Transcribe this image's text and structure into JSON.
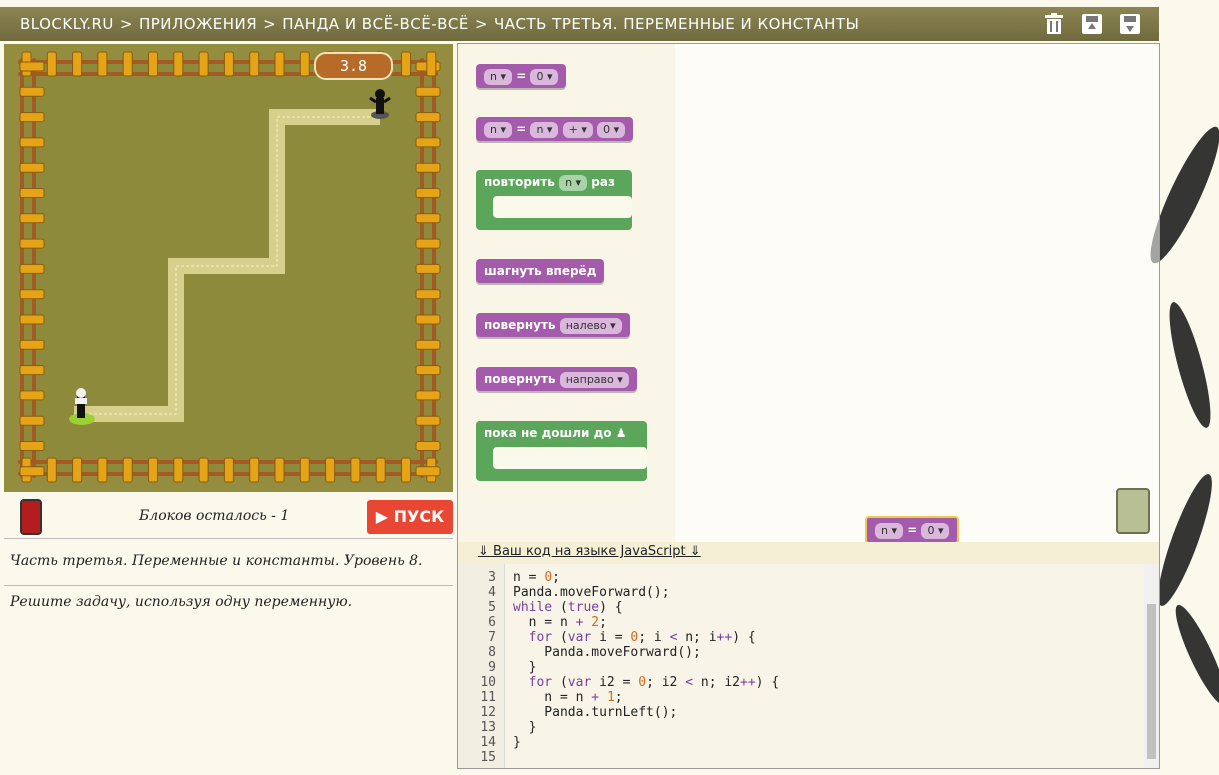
{
  "header": {
    "breadcrumb": [
      "BLOCKLY.RU",
      "ПРИЛОЖЕНИЯ",
      "ПАНДА И ВСЁ-ВСЁ-ВСЁ",
      "ЧАСТЬ ТРЕТЬЯ. ПЕРЕМЕННЫЕ И КОНСТАНТЫ"
    ],
    "separator": ">",
    "icons": [
      "trash-icon",
      "import-icon",
      "export-icon"
    ]
  },
  "game": {
    "timer": "3.8"
  },
  "status": {
    "blocks_left": "Блоков осталось - 1",
    "run_label": "ПУСК"
  },
  "level_title": "Часть третья. Переменные и константы. Уровень 8.",
  "task": "Решите задачу, используя одну переменную.",
  "toolbox": {
    "set_var": {
      "var": "n",
      "eq": "=",
      "value": "0"
    },
    "set_expr": {
      "var": "n",
      "eq": "=",
      "left": "n",
      "op": "+",
      "right": "0"
    },
    "repeat": {
      "label": "повторить",
      "var": "n",
      "suffix": "раз"
    },
    "step": {
      "label": "шагнуть вперёд"
    },
    "turn_left": {
      "label": "повернуть",
      "dir": "налево"
    },
    "turn_right": {
      "label": "повернуть",
      "dir": "направо"
    },
    "while": {
      "label": "пока не дошли до"
    }
  },
  "workspace_block": {
    "var": "n",
    "eq": "=",
    "value": "0"
  },
  "code": {
    "title": "Ваш код на языке JavaScript",
    "lines": [
      {
        "n": "3",
        "t": "n = 0;"
      },
      {
        "n": "4",
        "t": "Panda.moveForward();"
      },
      {
        "n": "5",
        "t": "while (true) {"
      },
      {
        "n": "6",
        "t": "  n = n + 2;"
      },
      {
        "n": "7",
        "t": "  for (var i = 0; i < n; i++) {"
      },
      {
        "n": "8",
        "t": "    Panda.moveForward();"
      },
      {
        "n": "9",
        "t": "  }"
      },
      {
        "n": "10",
        "t": "  for (var i2 = 0; i2 < n; i2++) {"
      },
      {
        "n": "11",
        "t": "    n = n + 1;"
      },
      {
        "n": "12",
        "t": "    Panda.turnLeft();"
      },
      {
        "n": "13",
        "t": "  }"
      },
      {
        "n": "14",
        "t": "}"
      },
      {
        "n": "15",
        "t": ""
      }
    ]
  }
}
